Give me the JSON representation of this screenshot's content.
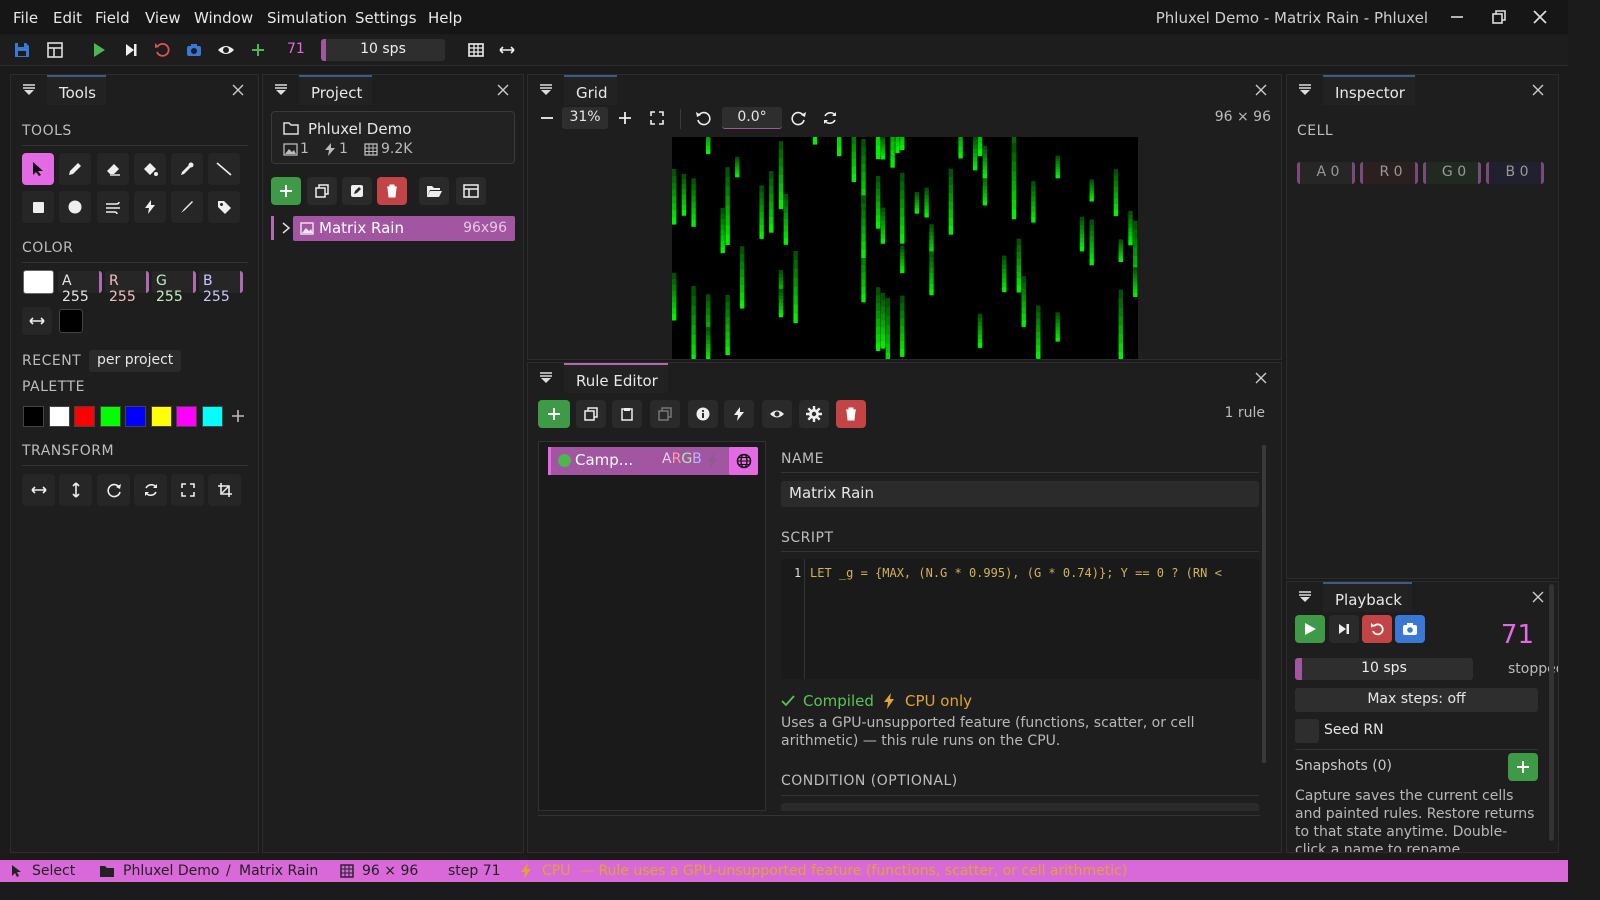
{
  "menubar": {
    "items": [
      "File",
      "Edit",
      "Field",
      "View",
      "Window",
      "Simulation",
      "Settings",
      "Help"
    ],
    "window_title": "Phluxel Demo - Matrix Rain - Phluxel"
  },
  "toolbar": {
    "step": "71",
    "speed": "10 sps",
    "speed_fraction": 0.04
  },
  "tools_panel": {
    "tab": "Tools",
    "tools_heading": "TOOLS",
    "color_heading": "COLOR",
    "channels": [
      "A 255",
      "R 255",
      "G 255",
      "B 255"
    ],
    "recent_heading": "RECENT",
    "recent_chip": "per project",
    "palette_heading": "PALETTE",
    "palette": [
      "#000000",
      "#ffffff",
      "#ff0000",
      "#00ff00",
      "#0000ff",
      "#ffff00",
      "#ff00ff",
      "#00ffff"
    ],
    "transform_heading": "TRANSFORM",
    "primary_color": "#ffffff",
    "secondary_color": "#000000"
  },
  "project_panel": {
    "tab": "Project",
    "project_name": "Phluxel Demo",
    "images_count": "1",
    "rules_count": "1",
    "size": "9.2K",
    "item_name": "Matrix Rain",
    "item_size": "96x96"
  },
  "grid_panel": {
    "tab": "Grid",
    "zoom": "31%",
    "rotation": "0.0°",
    "dims": "96 × 96"
  },
  "rule_editor": {
    "tab": "Rule Editor",
    "rule_count": "1 rule",
    "rule_item_name": "Camp...",
    "rule_item_channels": [
      "A",
      "R",
      "G",
      "B"
    ],
    "name_heading": "NAME",
    "name_value": "Matrix Rain",
    "script_heading": "SCRIPT",
    "line_number": "1",
    "script": "LET _g = {MAX, (N.G * 0.995), (G * 0.74)}; Y == 0 ? (RN <",
    "compiled": "Compiled",
    "cpu_only": "CPU only",
    "note": "Uses a GPU-unsupported feature (functions, scatter, or cell arithmetic) — this rule runs on the CPU.",
    "condition_heading": "CONDITION (OPTIONAL)"
  },
  "inspector": {
    "tab": "Inspector",
    "heading": "CELL",
    "channels": [
      "A 0",
      "R 0",
      "G 0",
      "B 0"
    ]
  },
  "playback": {
    "tab": "Playback",
    "step": "71",
    "speed": "10 sps",
    "state": "stopped",
    "max_steps": "Max steps: off",
    "seed": "Seed RN",
    "snapshots": "Snapshots (0)",
    "help": "Capture saves the current cells and painted rules. Restore returns to that state anytime. Double-click a name to rename."
  },
  "statusbar": {
    "tool": "Select",
    "project": "Phluxel Demo",
    "separator": "/",
    "image": "Matrix Rain",
    "dims": "96 × 96",
    "step": "step 71",
    "backend": "CPU",
    "message": "— Rule uses a GPU-unsupported feature (functions, scatter, or cell arithmetic)"
  },
  "colors": {
    "accent": "#e36ae3",
    "green": "#3f9a47",
    "red": "#c24444",
    "blue": "#3a78d6"
  }
}
